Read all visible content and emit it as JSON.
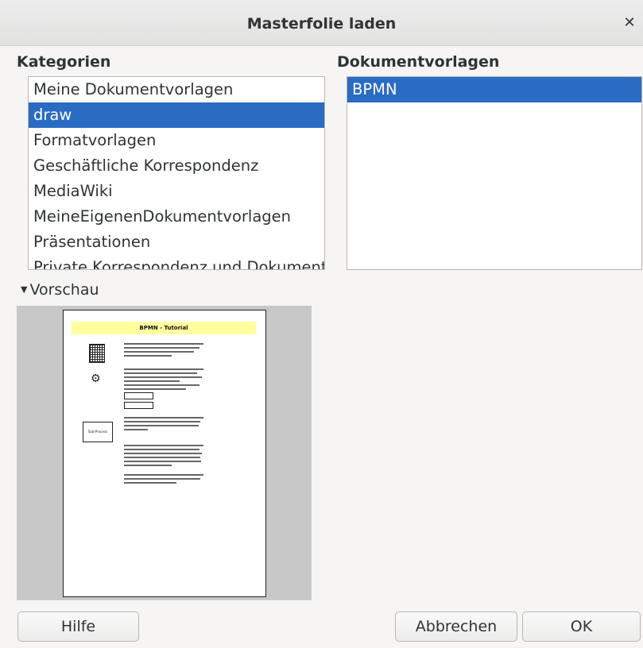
{
  "window": {
    "title": "Masterfolie laden"
  },
  "categories": {
    "label": "Kategorien",
    "items": [
      {
        "label": "Meine Dokumentvorlagen"
      },
      {
        "label": "draw"
      },
      {
        "label": "Formatvorlagen"
      },
      {
        "label": "Geschäftliche Korrespondenz"
      },
      {
        "label": "MediaWiki"
      },
      {
        "label": "MeineEigenenDokumentvorlagen"
      },
      {
        "label": "Präsentationen"
      },
      {
        "label": "Private Korrespondenz und Dokumente"
      }
    ],
    "selected": "draw"
  },
  "templates": {
    "label": "Dokumentvorlagen",
    "items": [
      {
        "label": "BPMN"
      }
    ],
    "selected": "BPMN"
  },
  "preview": {
    "label": "Vorschau",
    "page_title": "BPMN - Tutorial",
    "box_text": "Sub-Process"
  },
  "buttons": {
    "help": "Hilfe",
    "cancel": "Abbrechen",
    "ok": "OK"
  },
  "colors": {
    "selection": "#2a6bc4"
  }
}
